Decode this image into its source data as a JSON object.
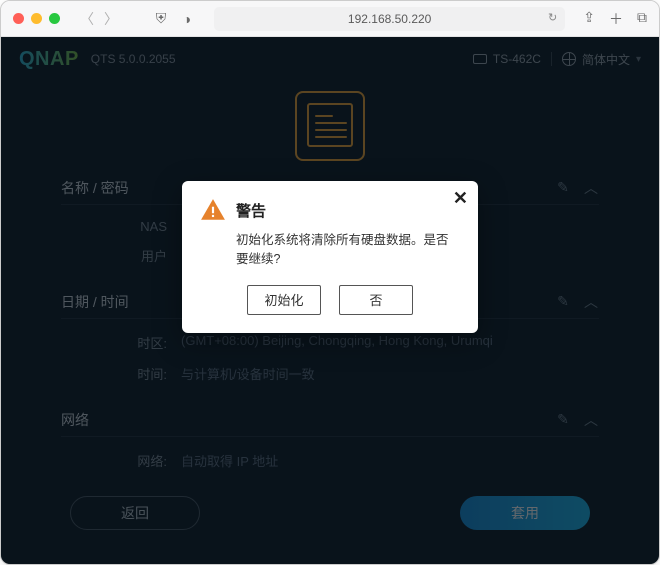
{
  "browser": {
    "address": "192.168.50.220"
  },
  "header": {
    "logo": "QNAP",
    "version": "QTS 5.0.0.2055",
    "device": "TS-462C",
    "language": "简体中文"
  },
  "sections": {
    "name_pwd": {
      "title": "名称 / 密码",
      "rows": {
        "nas": {
          "label": "NAS",
          "value": ""
        },
        "user": {
          "label": "用户",
          "value": ""
        }
      }
    },
    "datetime": {
      "title": "日期 / 时间",
      "rows": {
        "tz": {
          "label": "时区:",
          "value": "(GMT+08:00) Beijing, Chongqing, Hong Kong, Urumqi"
        },
        "time": {
          "label": "时间:",
          "value": "与计算机/设备时间一致"
        }
      }
    },
    "network": {
      "title": "网络",
      "rows": {
        "net": {
          "label": "网络:",
          "value": "自动取得 IP 地址"
        }
      }
    }
  },
  "footer": {
    "back": "返回",
    "apply": "套用"
  },
  "dialog": {
    "title": "警告",
    "message": "初始化系统将清除所有硬盘数据。是否要继续?",
    "confirm": "初始化",
    "cancel": "否"
  }
}
